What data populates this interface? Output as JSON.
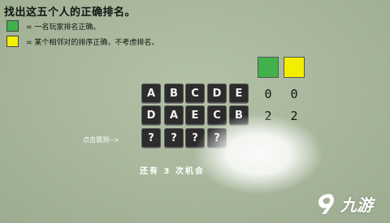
{
  "title": "找出这五个人的正确排名。",
  "legend": [
    {
      "color": "#3fb34a",
      "text": "= 一名玩家排名正确。"
    },
    {
      "color": "#f2ef00",
      "text": "= 某个相邻对的排序正确，不考虑排名。"
    }
  ],
  "score_colors": {
    "green": "#41b24b",
    "yellow": "#f4ee00"
  },
  "guesses": [
    {
      "letters": [
        "A",
        "B",
        "C",
        "D",
        "E"
      ],
      "green": "0",
      "yellow": "0"
    },
    {
      "letters": [
        "D",
        "A",
        "E",
        "C",
        "B"
      ],
      "green": "2",
      "yellow": "2"
    }
  ],
  "input_row": [
    "?",
    "?",
    "?",
    "?"
  ],
  "hint": "点击猜测-->",
  "chances_text": "还有 3 次机会",
  "watermark": "九游"
}
